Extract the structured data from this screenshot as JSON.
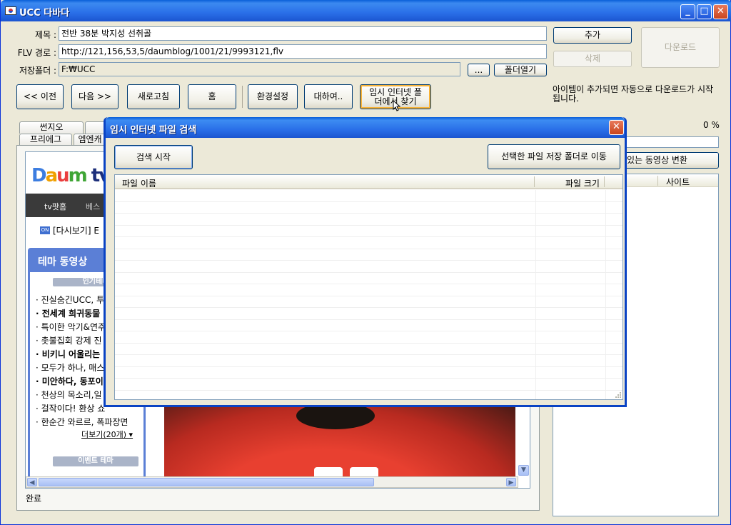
{
  "window": {
    "title": "UCC 다바다",
    "minimize": "_",
    "maximize": "□",
    "close": "✕"
  },
  "form": {
    "title_label": "제목 :",
    "title_value": "전반 38분 박지성 선취골",
    "flv_label": "FLV 경로 :",
    "flv_value": "http://121,156,53,5/daumblog/1001/21/9993121,flv",
    "folder_label": "저장폴더 :",
    "folder_value": "F:₩UCC",
    "browse_label": "...",
    "open_folder_label": "폴더열기",
    "add_label": "추가",
    "delete_label": "삭제",
    "download_label": "다운로드"
  },
  "toolbar": {
    "prev": "<< 이전",
    "next": "다음 >>",
    "refresh": "새로고침",
    "home": "홈",
    "settings": "환경설정",
    "about": "대하여..",
    "temp_find": "임시 인터넷 폴더에서 찾기"
  },
  "info_text": "아이템이 추가되면 자동으로 다운로드가 시작됩니다.",
  "progress_text": "0 %",
  "convert_label": "있는 동영상 변환",
  "list_col_site": "사이트",
  "tabs": {
    "row1": [
      "썬지오"
    ],
    "row2": [
      "프리에그",
      "엠엔캐"
    ]
  },
  "web": {
    "nav_items": [
      "tv팟홈",
      "베스"
    ],
    "replay": "[다시보기] E",
    "on_badge": "ON",
    "theme_title": "테마 동영상",
    "popular": "인기테마",
    "items": [
      {
        "text": "· 진실숨긴UCC, 투",
        "bold": false
      },
      {
        "text": "· 전세계 희귀동물",
        "bold": true
      },
      {
        "text": "· 특이한 악기&연주",
        "bold": false
      },
      {
        "text": "· 촛불집회 강제 진",
        "bold": false
      },
      {
        "text": "· 비키니 어울리는",
        "bold": true
      },
      {
        "text": "· 모두가 하나, 매스",
        "bold": false
      },
      {
        "text": "· 미안하다, 동포이",
        "bold": true
      },
      {
        "text": "· 천상의 목소리,일",
        "bold": false
      },
      {
        "text": "· 걸작이다! 환상 쇼",
        "bold": false
      },
      {
        "text": "· 한순간 와르르, 폭파장면",
        "bold": false
      }
    ],
    "more": "더보기(20개) ▾",
    "event_theme": "이벤트 테마"
  },
  "status": "완료",
  "dialog": {
    "title": "임시 인터넷 파일 검색",
    "close": "✕",
    "search_button": "검색 시작",
    "move_button": "선택한 파일 저장 폴더로 이동",
    "col_name": "파일 이름",
    "col_size": "파일 크기"
  }
}
